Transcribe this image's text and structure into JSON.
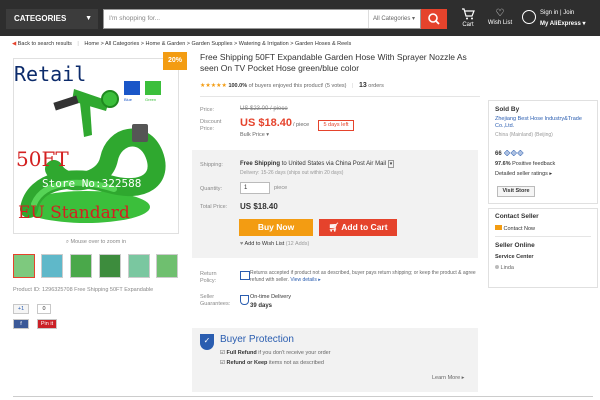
{
  "header": {
    "categories_label": "CATEGORIES",
    "search_placeholder": "I'm shopping for...",
    "search_category": "All Categories",
    "cart_label": "Cart",
    "wishlist_label": "Wish List",
    "signin_label": "Sign in | Join",
    "myaliexpress_label": "My AliExpress"
  },
  "breadcrumb": {
    "back": "Back to search results",
    "path": "Home > All Categories > Home & Garden > Garden Supplies > Watering & Irrigation > Garden Hoses & Reels"
  },
  "gallery": {
    "discount_badge": "20%",
    "overlay_retail": "Retail",
    "overlay_50ft": "50FT",
    "overlay_store": "Store No:322588",
    "overlay_eu": "EU Standard",
    "color_blue": "Blue",
    "color_green": "Green",
    "zoom_hint": "Mouse over to zoom in",
    "product_id": "Product ID: 1296325708 Free Shipping 50FT Expandable",
    "like_label": "+1",
    "like_count": "0",
    "fb_label": "f",
    "fb_count": "0",
    "pin_label": "Pin it"
  },
  "product": {
    "title": "Free Shipping 50FT Expandable Garden Hose With Sprayer Nozzle As seen On TV Pocket Hose green/blue color",
    "stars": "★★★★★",
    "rating_pct": "100.0%",
    "rating_text": "of buyers enjoyed this product! (5 votes)",
    "orders_count": "13",
    "orders_label": "orders",
    "price_label": "Price:",
    "original_price": "US $23.00 / piece",
    "discount_label": "Discount Price:",
    "discount_price": "US $18.40",
    "per_piece": "/ piece",
    "days_left": "5 days left",
    "bulk_price": "Bulk Price ▾",
    "shipping_label": "Shipping:",
    "shipping_free": "Free Shipping",
    "shipping_to": "to  United States via China Post Air Mail",
    "delivery_time": "Delivery: 15-26 days (ships out within 20 days)",
    "quantity_label": "Quantity:",
    "quantity_value": "1",
    "quantity_unit": "piece",
    "total_label": "Total Price:",
    "total_value": "US $18.40",
    "buy_now": "Buy Now",
    "add_to_cart": "Add to Cart",
    "add_wishlist": "Add to Wish List",
    "wishlist_adds": "(12 Adds)",
    "return_label": "Return Policy:",
    "return_text": "Returns accepted if product not as described, buyer pays return shipping; or keep the product & agree refund with seller.",
    "return_link": "View details ▸",
    "guarantee_label": "Seller Guarantees:",
    "guarantee_text": "On-time Delivery",
    "guarantee_days": "39 days"
  },
  "buyer_protection": {
    "title": "Buyer Protection",
    "item1_bold": "Full Refund",
    "item1_text": "if you don't receive your order",
    "item2_bold": "Refund or Keep",
    "item2_text": "items not as described",
    "learn_more": "Learn More ▸"
  },
  "seller": {
    "sold_by": "Sold By",
    "name": "Zhejiang Best Hose Industry&Trade Co.,Ltd.",
    "location": "China (Mainland) (Beijing)",
    "score": "66",
    "feedback_pct": "97.6%",
    "feedback_label": "Positive feedback",
    "ratings_link": "Detailed seller ratings ▸",
    "visit_store": "Visit Store",
    "contact_title": "Contact Seller",
    "contact_now": "Contact Now",
    "online_title": "Seller Online",
    "service_title": "Service Center",
    "service_name": "Linda"
  },
  "colors": {
    "accent_red": "#e5432c",
    "orange": "#f39c12",
    "header_bg": "#2e2e2e",
    "link_blue": "#2a5db0",
    "hose_green": "#3bbf3b"
  }
}
